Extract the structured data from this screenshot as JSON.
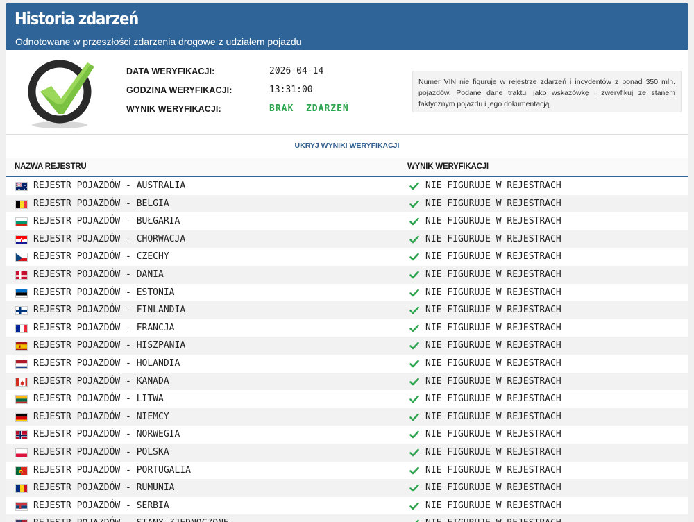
{
  "header": {
    "title": "Historia zdarzeń",
    "subtitle": "Odnotowane w przeszłości zdarzenia drogowe z udziałem pojazdu"
  },
  "summary": {
    "icon": "check-badge-icon",
    "date_label": "DATA WERYFIKACJI:",
    "date_value": "2026-04-14",
    "time_label": "GODZINA WERYFIKACJI:",
    "time_value": "13:31:00",
    "result_label": "WYNIK WERYFIKACJI:",
    "result_value": "BRAK  ZDARZEŃ",
    "notice": "Numer VIN nie figuruje w rejestrze zdarzeń i incydentów z ponad 350 mln. pojazdów. Podane dane traktuj jako wskazówkę i zweryfikuj ze stanem faktycznym pojazdu i jego dokumentacją."
  },
  "toggle_label": "UKRYJ WYNIKI WERYFIKACJI",
  "table": {
    "col_registry": "NAZWA REJESTRU",
    "col_result": "WYNIK WERYFIKACJI",
    "rows": [
      {
        "name": "REJESTR POJAZDÓW - AUSTRALIA",
        "flag": "au",
        "result": "NIE FIGURUJE W REJESTRACH"
      },
      {
        "name": "REJESTR POJAZDÓW - BELGIA",
        "flag": "be",
        "result": "NIE FIGURUJE W REJESTRACH"
      },
      {
        "name": "REJESTR POJAZDÓW - BUŁGARIA",
        "flag": "bg",
        "result": "NIE FIGURUJE W REJESTRACH"
      },
      {
        "name": "REJESTR POJAZDÓW - CHORWACJA",
        "flag": "hr",
        "result": "NIE FIGURUJE W REJESTRACH"
      },
      {
        "name": "REJESTR POJAZDÓW - CZECHY",
        "flag": "cz",
        "result": "NIE FIGURUJE W REJESTRACH"
      },
      {
        "name": "REJESTR POJAZDÓW - DANIA",
        "flag": "dk",
        "result": "NIE FIGURUJE W REJESTRACH"
      },
      {
        "name": "REJESTR POJAZDÓW - ESTONIA",
        "flag": "ee",
        "result": "NIE FIGURUJE W REJESTRACH"
      },
      {
        "name": "REJESTR POJAZDÓW - FINLANDIA",
        "flag": "fi",
        "result": "NIE FIGURUJE W REJESTRACH"
      },
      {
        "name": "REJESTR POJAZDÓW - FRANCJA",
        "flag": "fr",
        "result": "NIE FIGURUJE W REJESTRACH"
      },
      {
        "name": "REJESTR POJAZDÓW - HISZPANIA",
        "flag": "es",
        "result": "NIE FIGURUJE W REJESTRACH"
      },
      {
        "name": "REJESTR POJAZDÓW - HOLANDIA",
        "flag": "nl",
        "result": "NIE FIGURUJE W REJESTRACH"
      },
      {
        "name": "REJESTR POJAZDÓW - KANADA",
        "flag": "ca",
        "result": "NIE FIGURUJE W REJESTRACH"
      },
      {
        "name": "REJESTR POJAZDÓW - LITWA",
        "flag": "lt",
        "result": "NIE FIGURUJE W REJESTRACH"
      },
      {
        "name": "REJESTR POJAZDÓW - NIEMCY",
        "flag": "de",
        "result": "NIE FIGURUJE W REJESTRACH"
      },
      {
        "name": "REJESTR POJAZDÓW - NORWEGIA",
        "flag": "no",
        "result": "NIE FIGURUJE W REJESTRACH"
      },
      {
        "name": "REJESTR POJAZDÓW - POLSKA",
        "flag": "pl",
        "result": "NIE FIGURUJE W REJESTRACH"
      },
      {
        "name": "REJESTR POJAZDÓW - PORTUGALIA",
        "flag": "pt",
        "result": "NIE FIGURUJE W REJESTRACH"
      },
      {
        "name": "REJESTR POJAZDÓW - RUMUNIA",
        "flag": "ro",
        "result": "NIE FIGURUJE W REJESTRACH"
      },
      {
        "name": "REJESTR POJAZDÓW - SERBIA",
        "flag": "rs",
        "result": "NIE FIGURUJE W REJESTRACH"
      },
      {
        "name": "REJESTR POJAZDÓW - STANY ZJEDNOCZONE",
        "flag": "us",
        "result": "NIE FIGURUJE W REJESTRACH"
      }
    ]
  },
  "colors": {
    "header_bg": "#2f6498",
    "ok_green": "#2ea44f",
    "link": "#2f5f8f"
  }
}
